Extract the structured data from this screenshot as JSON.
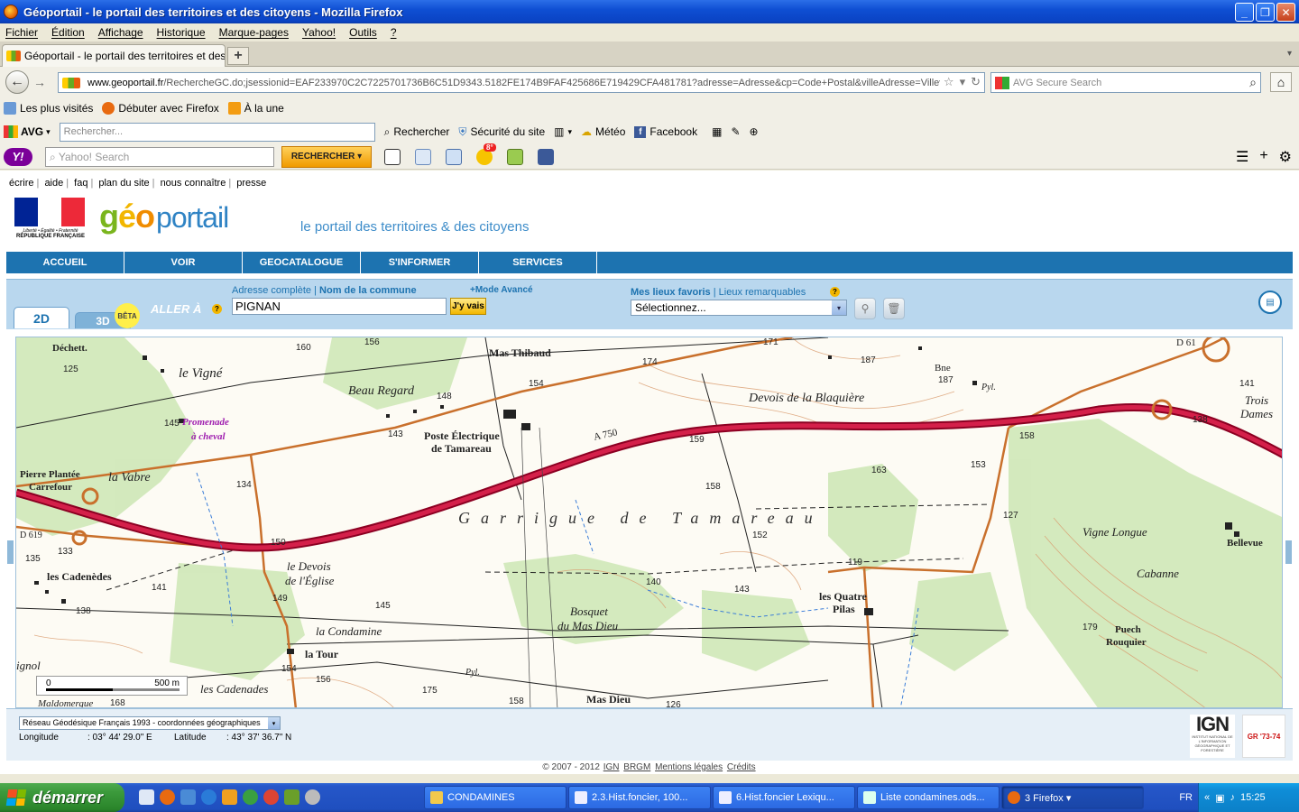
{
  "window": {
    "title": "Géoportail - le portail des territoires et des citoyens - Mozilla Firefox",
    "btn_min": "_",
    "btn_max": "❐",
    "btn_close": "✕"
  },
  "menubar": [
    "Fichier",
    "Édition",
    "Affichage",
    "Historique",
    "Marque-pages",
    "Yahoo!",
    "Outils",
    "?"
  ],
  "tabs": [
    {
      "label": "Géoportail - le portail des territoires et des ci..."
    }
  ],
  "tab_close": "×",
  "tab_new": "+",
  "tab_list": "▾",
  "nav": {
    "back": "←",
    "forward": "→",
    "url_host": "www.geoportail.fr",
    "url_path": "/RechercheGC.do;jsessionid=EAF233970C2C7225701736B6C51D9343.5182FE174B9FAF425686E719429CFA481781?adresse=Adresse&cp=Code+Postal&villeAdresse=Villeve",
    "url_star": "☆",
    "url_drop": "▾",
    "url_reload": "↻",
    "search_placeholder": "AVG Secure Search",
    "search_btn": "⌕",
    "home": "⌂"
  },
  "bookmarks": [
    "Les plus visités",
    "Débuter avec Firefox",
    "À la une"
  ],
  "avg_toolbar": {
    "logo": "AVG",
    "logo_drop": "▾",
    "placeholder": "Rechercher...",
    "items": [
      "Rechercher",
      "Sécurité du site",
      "Météo",
      "Facebook"
    ]
  },
  "yahoo_toolbar": {
    "logo": "Y!",
    "placeholder": "Yahoo! Search",
    "search_btn": "RECHERCHER ▾",
    "badge": "8°",
    "right_icons": [
      "☰",
      "+",
      "⚙"
    ]
  },
  "page": {
    "top_links": [
      "écrire",
      "aide",
      "faq",
      "plan du site",
      "nous connaître",
      "presse"
    ],
    "top_links_sep": "|",
    "republique": {
      "motto": "Liberté • Égalité • Fraternité",
      "name": "RÉPUBLIQUE FRANÇAISE"
    },
    "logo": {
      "g": "g",
      "e": "é",
      "o": "o",
      "rest": "portail"
    },
    "slogan": "le portail des territoires & des citoyens",
    "main_nav": [
      "ACCUEIL",
      "VOIR",
      "GEOCATALOGUE",
      "S'INFORMER",
      "SERVICES"
    ],
    "tools": {
      "tab_2d": "2D",
      "tab_3d": "3D",
      "beta": "BÊTA",
      "aller_a": "ALLER À",
      "help": "?",
      "addr_link1": "Adresse complète",
      "link_sep": "|",
      "addr_link2": "Nom de la commune",
      "mode_avance": "+Mode Avancé",
      "addr_value": "PIGNAN",
      "go_button": "J'y vais",
      "fav_link1": "Mes lieux favoris",
      "fav_link2": "Lieux remarquables",
      "fav_select": "Sélectionnez...",
      "select_drop": "▾",
      "pin_icon": "⚲",
      "trash_icon": "🗑",
      "panel_icon": "▤"
    },
    "map": {
      "labels": {
        "dechett": "Déchett.",
        "vigne": "le Vigné",
        "mas_thibaud": "Mas Thibaud",
        "beau_regard": "Beau Regard",
        "poste1": "Poste Électrique",
        "poste2": "de Tamareau",
        "devois_blaq": "Devois de la Blaquière",
        "bne": "Bne",
        "pyl": "Pyl.",
        "trois_dames": "Trois Dames",
        "promenade1": "Promenade",
        "promenade2": "à cheval",
        "a750": "A 750",
        "d61": "D 61",
        "pierre1": "Pierre Plantée",
        "pierre2": "Carrefour",
        "vabre": "la Vabre",
        "d619": "D 619",
        "cadenedes": "les Cadenèdes",
        "devois_eglise1": "le Devois",
        "devois_eglise2": "de l'Église",
        "condamine": "la Condamine",
        "la_tour": "la Tour",
        "bosquet1": "Bosquet",
        "bosquet2": "du Mas Dieu",
        "quatre1": "les Quatre",
        "quatre2": "Pilas",
        "mas_dieu": "Mas Dieu",
        "cadenades": "les Cadenades",
        "vigne_longue": "Vigne Longue",
        "bellevue": "Bellevue",
        "cabanne": "Cabanne",
        "puech1": "Puech",
        "puech2": "Rouquier",
        "ignol": "ignol",
        "maldomerg": "Maldomergue",
        "pyl2": "Pyl."
      },
      "garrigue": "Garrigue de Tamareau",
      "numbers": {
        "n125": "125",
        "n160": "160",
        "n156": "156",
        "n145": "145",
        "n143": "143",
        "n148": "148",
        "n154": "154",
        "n174": "174",
        "n171": "171",
        "n187a": "187",
        "n187b": "187",
        "n141": "141",
        "n138a": "138",
        "n158a": "158",
        "n159": "159",
        "n163": "163",
        "n153": "153",
        "n127": "127",
        "n134": "134",
        "n133": "133",
        "n135": "135",
        "n150": "150",
        "n158b": "158",
        "n152": "152",
        "n119": "119",
        "n140": "140",
        "n143b": "143",
        "n149": "149",
        "n145b": "145",
        "n138b": "138",
        "n141b": "141",
        "n154b": "154",
        "n156b": "156",
        "n175": "175",
        "n158c": "158",
        "n126": "126",
        "n179": "179",
        "n168": "168"
      },
      "scale": {
        "zero": "0",
        "dist": "500 m"
      }
    },
    "bottom": {
      "crs": "Réseau Géodésique Français 1993 - coordonnées géographiques",
      "crs_drop": "▾",
      "lon_label": "Longitude",
      "lon_value": ": 03° 44' 29.0\" E",
      "lat_label": "Latitude",
      "lat_value": ": 43° 37' 36.7\" N",
      "ign": "IGN",
      "ign_sub": "INSTITUT NATIONAL DE L'INFORMATION GÉOGRAPHIQUE ET FORESTIÈRE",
      "gr": "GR '73-74"
    },
    "copyright": "© 2007 - 2012",
    "copyright_links": [
      "IGN",
      "BRGM",
      "Mentions légales",
      "Crédits"
    ]
  },
  "taskbar": {
    "start": "démarrer",
    "items": [
      "CONDAMINES",
      "2.3.Hist.foncier, 100...",
      "6.Hist.foncier Lexiqu...",
      "Liste condamines.ods...",
      "3 Firefox ▾"
    ],
    "lang": "FR",
    "time": "15:25"
  },
  "colors": {
    "geo_blue": "#1d73b0",
    "highway": "#c0123a",
    "forest": "#c8e6b0"
  }
}
